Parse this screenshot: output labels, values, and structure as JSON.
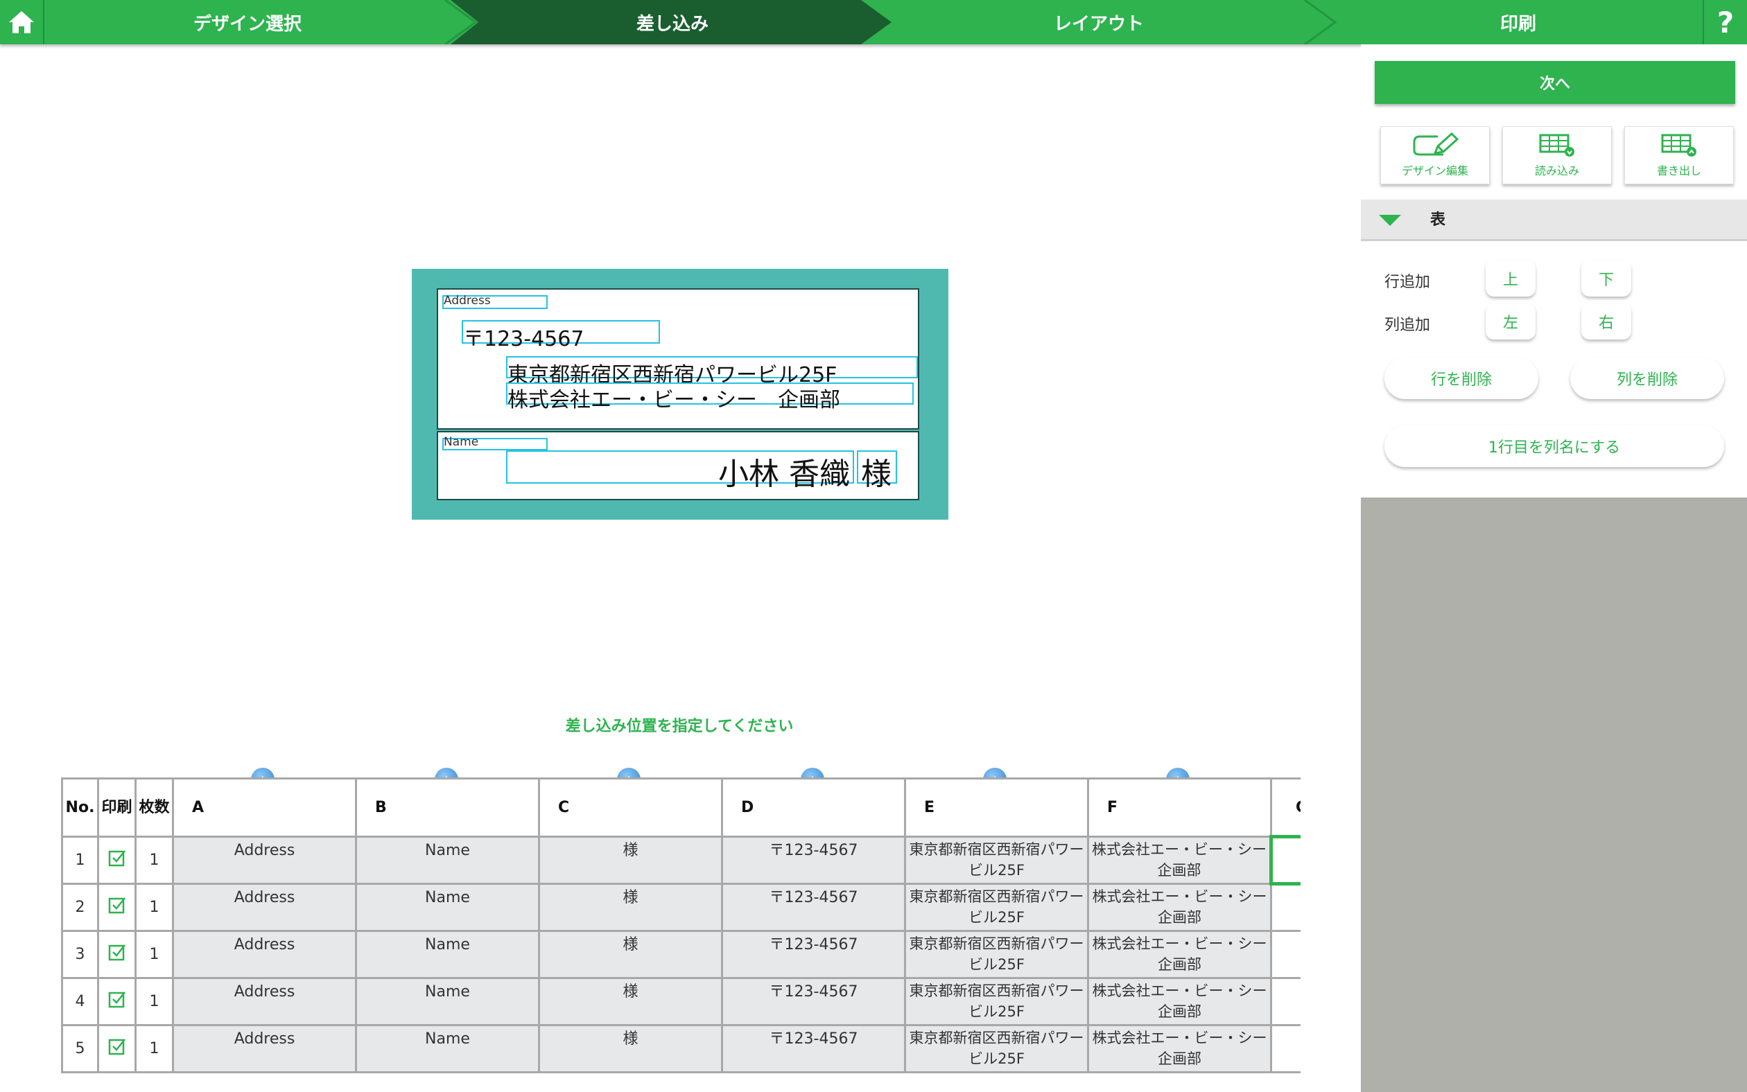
{
  "steps": [
    "デザイン選択",
    "差し込み",
    "レイアウト",
    "印刷"
  ],
  "help_label": "?",
  "right_panel": {
    "next_label": "次へ",
    "tools": [
      "デザイン編集",
      "読み込み",
      "書き出し"
    ],
    "section_title": "表",
    "row_add_label": "行追加",
    "col_add_label": "列追加",
    "row_up": "上",
    "row_down": "下",
    "col_left": "左",
    "col_right": "右",
    "delete_row": "行を削除",
    "delete_col": "列を削除",
    "first_row_header": "1行目を列名にする"
  },
  "preview": {
    "address_label": "Address",
    "name_label": "Name",
    "postal": "〒123-4567",
    "address_line1": "東京都新宿区西新宿パワービル25F",
    "address_line2": "株式会社エー・ビー・シー　企画部",
    "person_name": "小林 香織",
    "honorific": "様"
  },
  "instruction": "差し込み位置を指定してください",
  "table": {
    "headers": [
      "No.",
      "印刷",
      "枚数",
      "A",
      "B",
      "C",
      "D",
      "E",
      "F",
      "G"
    ],
    "rows": [
      {
        "no": "1",
        "count": "1",
        "cells": [
          "Address",
          "Name",
          "様",
          "〒123-4567",
          "東京都新宿区西新宿パワービル25F",
          "株式会社エー・ビー・シー　企画部"
        ]
      },
      {
        "no": "2",
        "count": "1",
        "cells": [
          "Address",
          "Name",
          "様",
          "〒123-4567",
          "東京都新宿区西新宿パワービル25F",
          "株式会社エー・ビー・シー　企画部"
        ]
      },
      {
        "no": "3",
        "count": "1",
        "cells": [
          "Address",
          "Name",
          "様",
          "〒123-4567",
          "東京都新宿区西新宿パワービル25F",
          "株式会社エー・ビー・シー　企画部"
        ]
      },
      {
        "no": "4",
        "count": "1",
        "cells": [
          "Address",
          "Name",
          "様",
          "〒123-4567",
          "東京都新宿区西新宿パワービル25F",
          "株式会社エー・ビー・シー　企画部"
        ]
      },
      {
        "no": "5",
        "count": "1",
        "cells": [
          "Address",
          "Name",
          "様",
          "〒123-4567",
          "東京都新宿区西新宿パワービル25F",
          "株式会社エー・ビー・シー　企画部"
        ]
      }
    ]
  },
  "colors": {
    "accent": "#2eb34f",
    "active_step": "#1a5e30",
    "card_bg": "#4fb9b0",
    "field_outline": "#24c3e2"
  }
}
